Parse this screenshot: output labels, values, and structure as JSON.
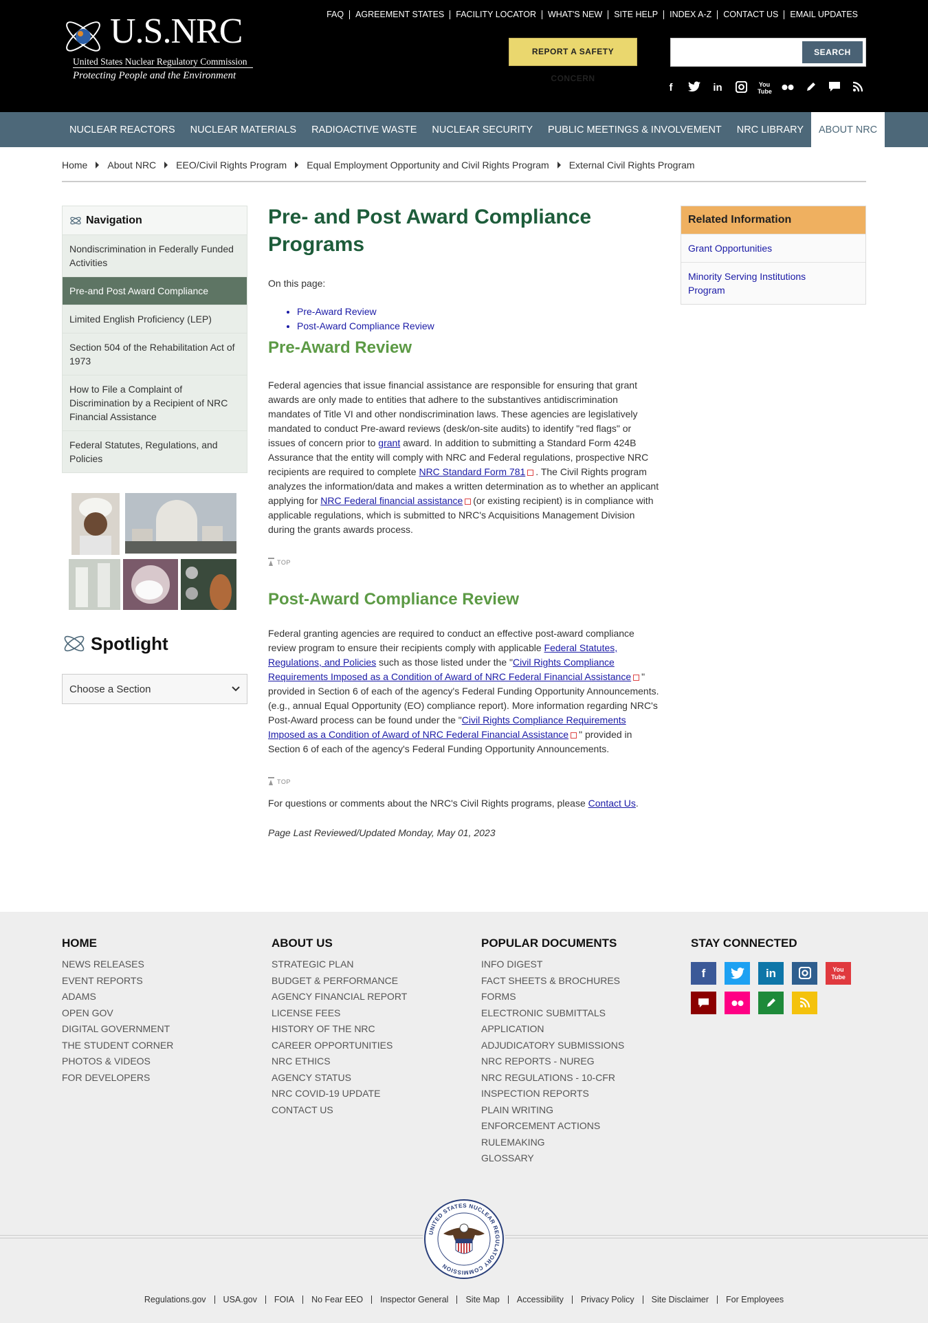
{
  "header": {
    "brand": "U.S.NRC",
    "agency": "United States Nuclear Regulatory Commission",
    "tagline": "Protecting People and the Environment",
    "utility_links": [
      "FAQ",
      "AGREEMENT STATES",
      "FACILITY LOCATOR",
      "WHAT'S NEW",
      "SITE HELP",
      "INDEX A-Z",
      "CONTACT US",
      "EMAIL UPDATES"
    ],
    "report_button": "REPORT A SAFETY CONCERN",
    "search_button": "SEARCH",
    "search_placeholder": "",
    "social_icons": [
      "facebook-icon",
      "twitter-icon",
      "linkedin-icon",
      "instagram-icon",
      "youtube-icon",
      "flickr-icon",
      "blog-icon",
      "chat-icon",
      "rss-icon"
    ]
  },
  "nav": {
    "items": [
      "NUCLEAR REACTORS",
      "NUCLEAR MATERIALS",
      "RADIOACTIVE WASTE",
      "NUCLEAR SECURITY",
      "PUBLIC MEETINGS & INVOLVEMENT",
      "NRC LIBRARY",
      "ABOUT NRC"
    ],
    "active": "ABOUT NRC"
  },
  "breadcrumb": [
    "Home",
    "About NRC",
    "EEO/Civil Rights Program",
    "Equal Employment Opportunity and Civil Rights Program",
    "External Civil Rights Program"
  ],
  "sidebar": {
    "title": "Navigation",
    "items": [
      "Nondiscrimination in Federally Funded Activities",
      "Pre-and Post Award Compliance",
      "Limited English Proficiency (LEP)",
      "Section 504 of the Rehabilitation Act of 1973",
      "How to File a Complaint of Discrimination by a Recipient of NRC Financial Assistance",
      "Federal Statutes, Regulations, and Policies"
    ],
    "spotlight": "Spotlight",
    "section_select": "Choose a Section"
  },
  "main": {
    "title": "Pre- and Post Award Compliance Programs",
    "on_this_page": "On this page:",
    "toc": [
      "Pre-Award Review",
      "Post-Award Compliance Review"
    ],
    "pre_heading": "Pre-Award Review",
    "pre_p1": "Federal agencies that issue financial assistance are responsible for ensuring that grant awards are only made to entities that adhere to the substantives antidiscrimination mandates of Title VI and other nondiscrimination laws. These agencies are legislatively mandated to conduct Pre-award reviews (desk/on-site audits) to identify \"red flags\" or issues of concern prior to",
    "pre_link_grant": "grant",
    "pre_p2": "award. In addition to submitting a Standard Form 424B Assurance that the entity will comply with NRC and Federal regulations, prospective NRC recipients are required to complete",
    "pre_link_form": "NRC Standard Form 781",
    "pre_p3": ". The Civil Rights program analyzes the information/data and makes a written determination as to whether an applicant applying for",
    "pre_link_fin": "NRC Federal financial assistance",
    "pre_p4": "(or existing recipient) is in compliance with applicable regulations, which is submitted to NRC's Acquisitions Management Division during the grants awards process.",
    "top_label": "TOP",
    "post_heading": "Post-Award Compliance Review",
    "post_p1": "Federal granting agencies are required to conduct an effective post-award compliance review program to ensure their recipients comply with applicable",
    "post_link_statutes": "Federal Statutes, Regulations, and Policies",
    "post_p2": "such as those listed under the \"",
    "post_link_req1": "Civil Rights Compliance Requirements Imposed as a Condition of Award of NRC Federal Financial Assistance",
    "post_p3": "\" provided in Section 6 of each of the agency's Federal Funding Opportunity Announcements. (e.g., annual Equal Opportunity (EO) compliance report). More information regarding NRC's Post-Award process can be found under the \"",
    "post_link_req2": "Civil Rights Compliance Requirements Imposed as a Condition of Award of NRC Federal Financial Assistance",
    "post_p4": "\" provided in Section 6 of each of the agency's Federal Funding Opportunity Announcements.",
    "questions_pre": "For questions or comments about the NRC's Civil Rights programs, please",
    "questions_link": "Contact Us",
    "questions_post": ".",
    "last_reviewed": "Page Last Reviewed/Updated Monday, May 01, 2023"
  },
  "related": {
    "title": "Related Information",
    "items": [
      "Grant Opportunities",
      "Minority Serving Institutions Program"
    ]
  },
  "footer": {
    "home": {
      "title": "HOME",
      "links": [
        "NEWS RELEASES",
        "EVENT REPORTS",
        "ADAMS",
        "OPEN GOV",
        "DIGITAL GOVERNMENT",
        "THE STUDENT CORNER",
        "PHOTOS & VIDEOS",
        "FOR DEVELOPERS"
      ]
    },
    "about": {
      "title": "ABOUT US",
      "links": [
        "STRATEGIC PLAN",
        "BUDGET & PERFORMANCE",
        "AGENCY FINANCIAL REPORT",
        "LICENSE FEES",
        "HISTORY OF THE NRC",
        "CAREER OPPORTUNITIES",
        "NRC ETHICS",
        "AGENCY STATUS",
        "NRC COVID-19 UPDATE",
        "CONTACT US"
      ]
    },
    "docs": {
      "title": "POPULAR DOCUMENTS",
      "links": [
        "INFO DIGEST",
        "FACT SHEETS & BROCHURES",
        "FORMS",
        "ELECTRONIC SUBMITTALS",
        "APPLICATION",
        "ADJUDICATORY SUBMISSIONS",
        "NRC REPORTS - NUREG",
        "NRC REGULATIONS - 10-CFR",
        "INSPECTION REPORTS",
        "PLAIN WRITING",
        "ENFORCEMENT ACTIONS",
        "RULEMAKING",
        "GLOSSARY"
      ]
    },
    "connect": {
      "title": "STAY CONNECTED"
    },
    "social_colors": [
      "#3b5998",
      "#1da1f2",
      "#0e76a8",
      "#2e5e8e",
      "#e0393e",
      "#8b0000",
      "#ff0084",
      "#1e8a3a",
      "#f4c20d"
    ],
    "seal_text": "UNITED STATES NUCLEAR REGULATORY COMMISSION",
    "bottom_links": [
      "Regulations.gov",
      "USA.gov",
      "FOIA",
      "No Fear EEO",
      "Inspector General",
      "Site Map",
      "Accessibility",
      "Privacy Policy",
      "Site Disclaimer",
      "For Employees"
    ]
  }
}
